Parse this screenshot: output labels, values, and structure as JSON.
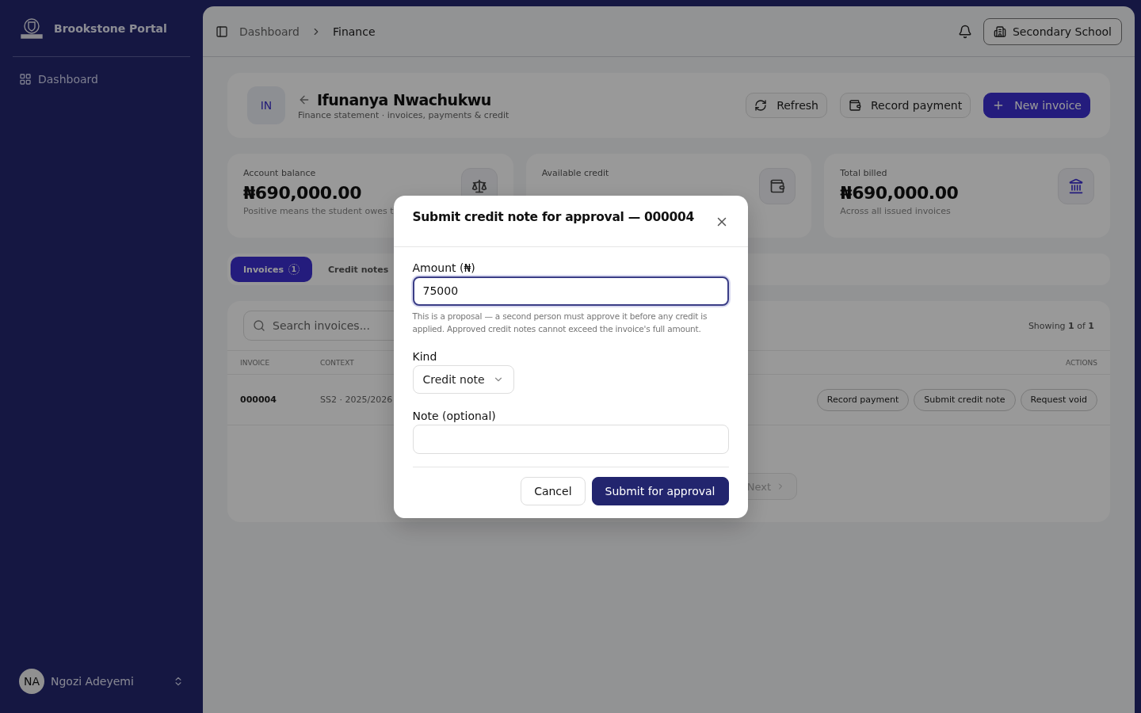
{
  "sidebar": {
    "brand": "Brookstone Portal",
    "nav": [
      {
        "label": "Dashboard",
        "selected": false
      }
    ],
    "user": {
      "initials": "NA",
      "name": "Ngozi Adeyemi"
    }
  },
  "topbar": {
    "breadcrumbs": [
      "Dashboard",
      "Finance"
    ],
    "school": "Secondary School"
  },
  "profile": {
    "initials": "IN",
    "name": "Ifunanya Nwachukwu",
    "subtitle": "Finance statement · invoices, payments & credit",
    "actions": [
      {
        "label": "Refresh",
        "kind": "refresh"
      },
      {
        "label": "Record payment",
        "kind": "wallet"
      },
      {
        "label": "New invoice",
        "kind": "add"
      }
    ]
  },
  "stats": [
    {
      "label": "Account balance",
      "value": "₦690,000.00",
      "note": "Positive means the student owes t",
      "kind": "balance"
    },
    {
      "label": "Available credit",
      "kind": "wallet"
    },
    {
      "label": "Total billed",
      "value": "₦690,000.00",
      "note": "Across all issued invoices",
      "kind": "bank"
    }
  ],
  "tabs": [
    {
      "label": "Invoices",
      "count": "1",
      "selected": true
    },
    {
      "label": "Credit notes",
      "selected": false
    }
  ],
  "table": {
    "search_placeholder": "Search invoices...",
    "showing": "Showing **1** of **1**",
    "columns": [
      "INVOICE",
      "CONTEXT",
      "ACTIONS"
    ],
    "rows": [
      {
        "invoice": "000004",
        "context": "SS2 · 2025/2026",
        "actions": [
          "Record payment",
          "Submit credit note",
          "Request void"
        ]
      }
    ],
    "next": "Next"
  },
  "modal": {
    "title": "Submit credit note for approval — 000004",
    "amount_label": "Amount (₦)",
    "amount": "75000",
    "hint": "This is a proposal — a second person must approve it before any credit is applied. Approved credit notes cannot exceed the invoice's full amount.",
    "kind_label": "Kind",
    "kind_value": "Credit note",
    "note_label": "Note (optional)",
    "buttons": [
      {
        "label": "Cancel",
        "primary": false
      },
      {
        "label": "Submit for approval",
        "primary": true
      }
    ]
  }
}
